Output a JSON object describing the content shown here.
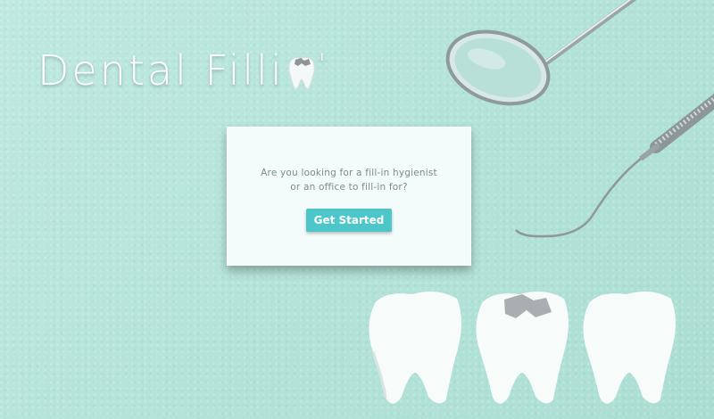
{
  "brand": {
    "title": "Dental Filli",
    "tick": "'"
  },
  "card": {
    "prompt": "Are you looking for a fill-in hygienist or an office to fill-in for?",
    "cta_label": "Get Started"
  },
  "colors": {
    "background": "#b7e6dc",
    "accent": "#4cc6c9",
    "card": "#f3fcfa"
  }
}
